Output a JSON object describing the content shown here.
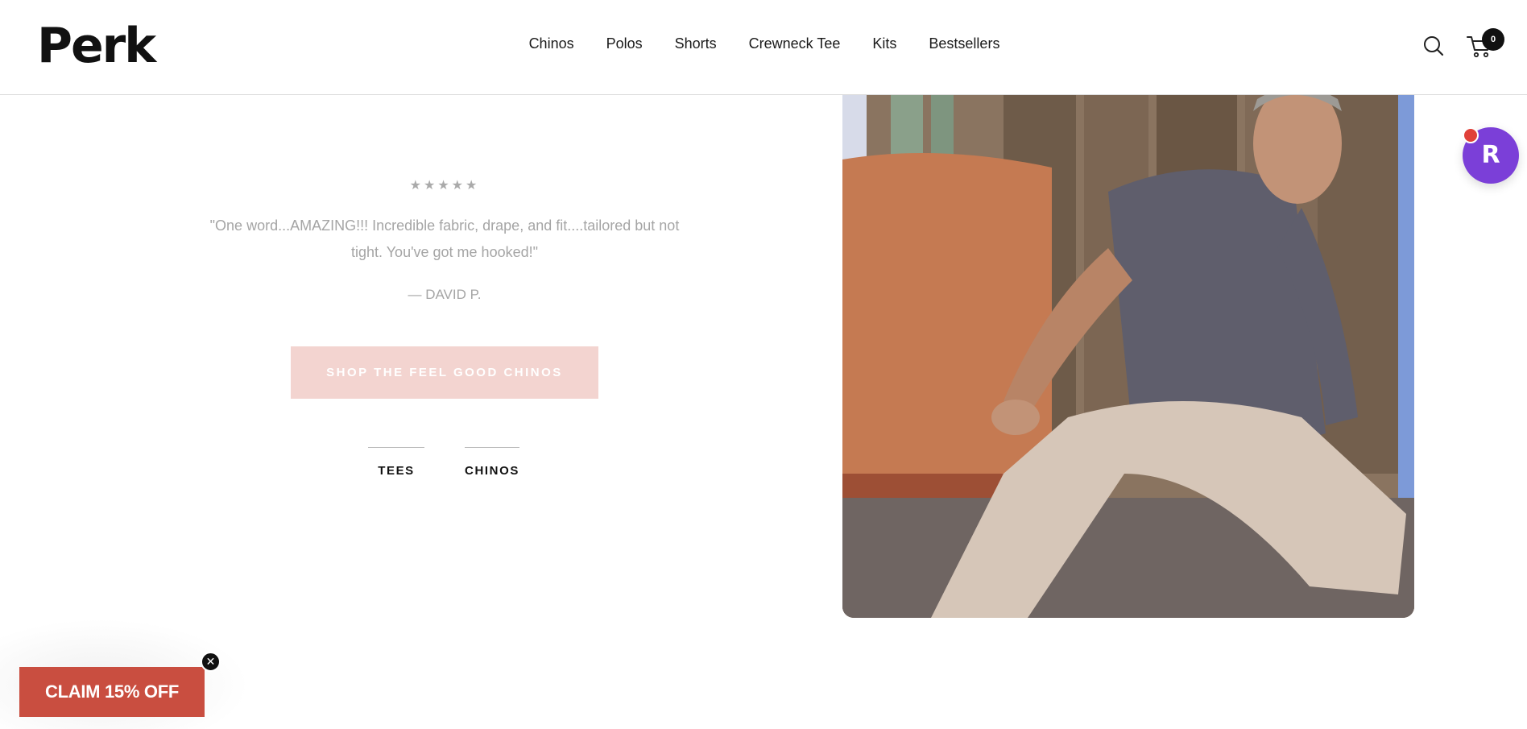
{
  "header": {
    "logo": "Perk",
    "nav": [
      "Chinos",
      "Polos",
      "Shorts",
      "Crewneck Tee",
      "Kits",
      "Bestsellers"
    ],
    "cart_count": "0",
    "search_icon": "search-icon",
    "cart_icon": "cart-icon"
  },
  "testimonial": {
    "stars": "★★★★★",
    "quote": "\"One word...AMAZING!!! Incredible fabric, drape, and fit....tailored but not tight. You've got me hooked!\"",
    "author": "— DAVID P."
  },
  "cta": {
    "label": "SHOP THE FEEL GOOD CHINOS",
    "color": "#f3d4d0"
  },
  "tabs": [
    "TEES",
    "CHINOS"
  ],
  "rewards": {
    "letter": "R",
    "color": "#7b3fd8"
  },
  "promo": {
    "label": "CLAIM 15% OFF",
    "close": "✕",
    "color": "#c94e40"
  }
}
